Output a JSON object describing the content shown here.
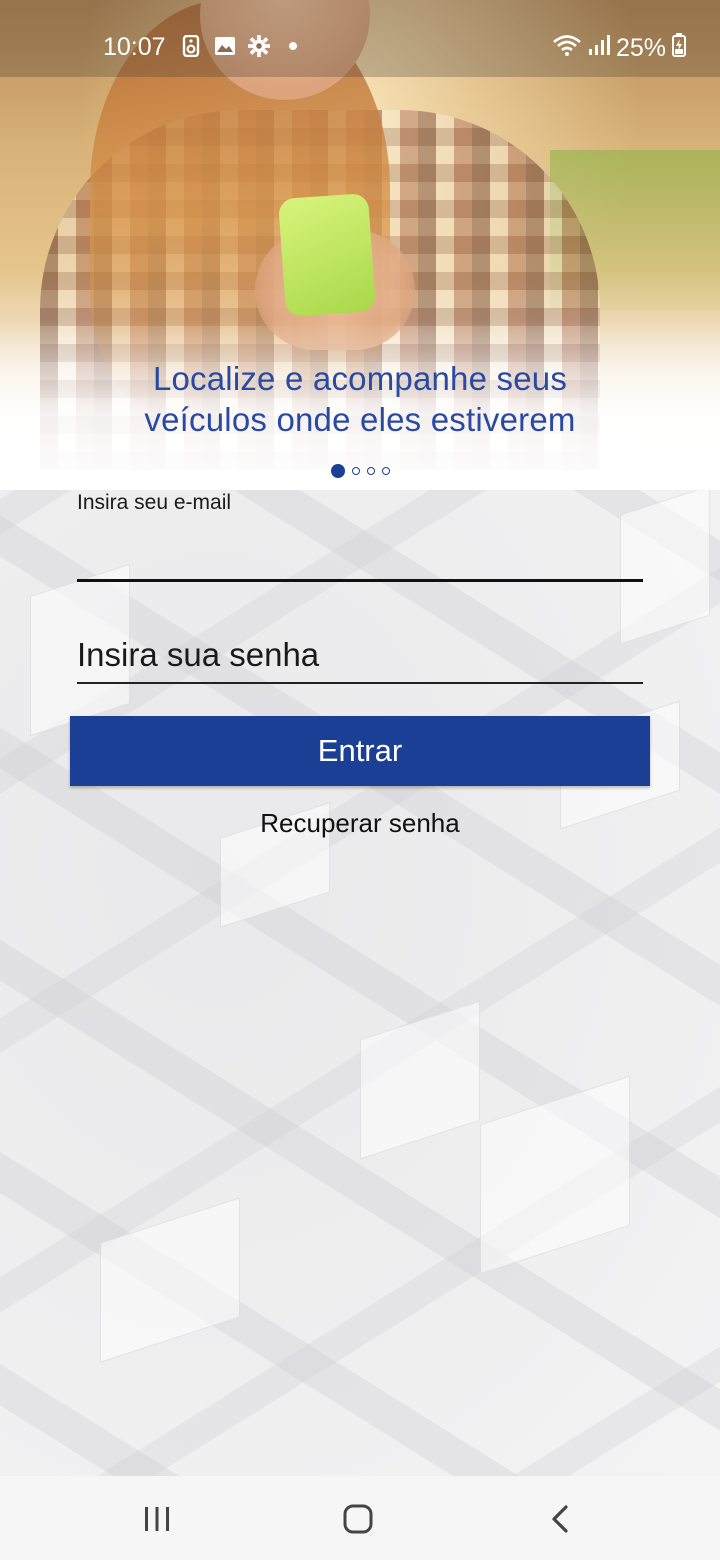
{
  "status_bar": {
    "time": "10:07",
    "battery": "25%",
    "left_icons": [
      "notification-app-icon",
      "gallery-icon",
      "settings-icon",
      "dot-icon"
    ],
    "right_icons": [
      "wifi-icon",
      "signal-icon",
      "battery-charging-icon"
    ]
  },
  "hero": {
    "caption_line1": "Localize e acompanhe seus",
    "caption_line2": "veículos onde eles estiverem",
    "carousel_page": 1,
    "carousel_total": 4
  },
  "form": {
    "email_label": "Insira seu e-mail",
    "email_value": "",
    "password_placeholder": "Insira sua senha",
    "login_label": "Entrar",
    "recover_label": "Recuperar senha"
  },
  "colors": {
    "brand": "#1c3f96",
    "caption": "#2a4aa1"
  },
  "nav_bar": {
    "buttons": [
      "recent-apps-icon",
      "home-icon",
      "back-icon"
    ]
  }
}
